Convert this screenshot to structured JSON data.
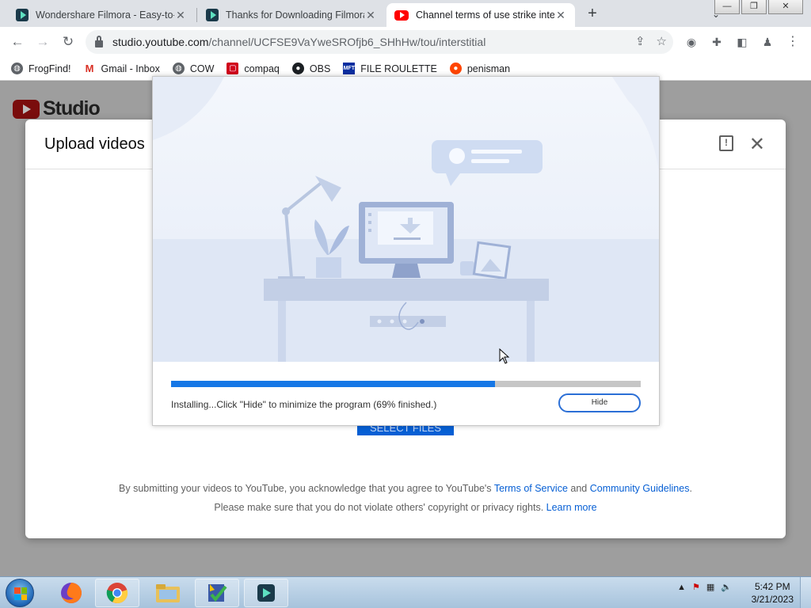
{
  "tabs": [
    {
      "title": "Wondershare Filmora - Easy-to-U",
      "favicon": "filmora-icon"
    },
    {
      "title": "Thanks for Downloading Filmora",
      "favicon": "filmora-icon"
    },
    {
      "title": "Channel terms of use strike inter",
      "favicon": "youtube-icon",
      "active": true
    }
  ],
  "url": {
    "host": "studio.youtube.com",
    "path": "/channel/UCFSE9VaYweSROfjb6_SHhHw/tou/interstitial"
  },
  "bookmarks": [
    {
      "label": "FrogFind!",
      "icon": "globe-icon"
    },
    {
      "label": "Gmail - Inbox",
      "icon": "gmail-icon"
    },
    {
      "label": "COW",
      "icon": "globe-icon"
    },
    {
      "label": "compaq",
      "icon": "compaq-icon"
    },
    {
      "label": "OBS",
      "icon": "github-icon"
    },
    {
      "label": "FILE ROULETTE",
      "icon": "mft-icon"
    },
    {
      "label": "penisman",
      "icon": "reddit-icon"
    }
  ],
  "studio": {
    "logo_text": "Studio",
    "upload_title": "Upload videos",
    "select_button": "SELECT FILES",
    "legal_line1_prefix": "By submitting your videos to YouTube, you acknowledge that you agree to YouTube's ",
    "terms_link": "Terms of Service",
    "and": " and ",
    "guidelines_link": "Community Guidelines",
    "period": ".",
    "legal_line2_prefix": "Please make sure that you do not violate others' copyright or privacy rights. ",
    "learn_more_link": "Learn more"
  },
  "installer": {
    "status_text": "Installing...Click \"Hide\" to minimize the program (69% finished.)",
    "progress_percent": 69,
    "hide_button": "Hide"
  },
  "taskbar": {
    "time": "5:42 PM",
    "date": "3/21/2023"
  },
  "colors": {
    "accent_blue": "#1677e6",
    "youtube_red": "#ff0000",
    "link_blue": "#065fd4"
  }
}
